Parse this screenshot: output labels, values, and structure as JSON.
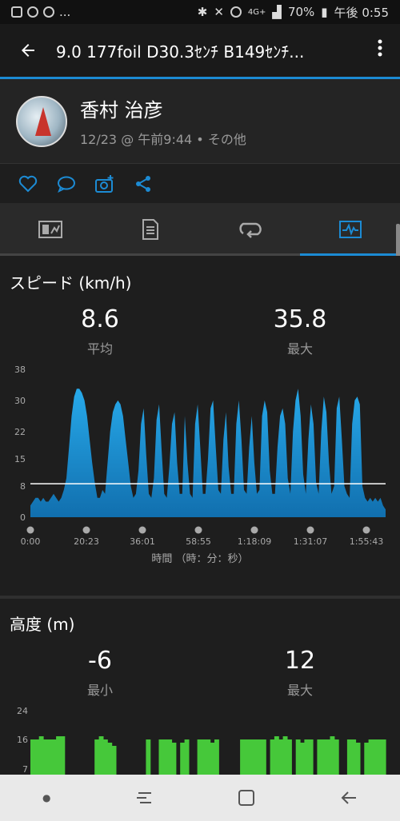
{
  "status_bar": {
    "left_icons": [
      "image-icon",
      "sync-icon",
      "message-icon"
    ],
    "left_more": "...",
    "battery": "70%",
    "time": "午後 0:55",
    "network": "4G+"
  },
  "app_bar": {
    "title": "9.0  177foil  D30.3ｾﾝﾁ  B149ｾﾝﾁ...",
    "back_icon": "arrow-left-icon",
    "more_icon": "overflow-menu-icon"
  },
  "profile": {
    "name": "香村 治彦",
    "meta": "12/23 @ 午前9:44 • その他"
  },
  "actions": [
    "heart-icon",
    "comment-icon",
    "add-photo-icon",
    "share-icon"
  ],
  "tabs": [
    {
      "icon": "overview-icon",
      "active": false
    },
    {
      "icon": "details-icon",
      "active": false
    },
    {
      "icon": "laps-icon",
      "active": false
    },
    {
      "icon": "charts-icon",
      "active": true
    }
  ],
  "speed": {
    "title": "スピード (km/h)",
    "avg_value": "8.6",
    "avg_label": "平均",
    "max_value": "35.8",
    "max_label": "最大",
    "xlabel": "時間 （時：分：秒）"
  },
  "altitude": {
    "title": "高度 (m)",
    "min_value": "-6",
    "min_label": "最小",
    "max_value": "12",
    "max_label": "最大"
  },
  "colors": {
    "accent": "#1c8bd4",
    "speed_fill": "#1a97d6",
    "altitude_fill": "#46c83a"
  },
  "chart_data": [
    {
      "type": "area",
      "title": "スピード (km/h)",
      "xlabel": "時間 （時：分：秒）",
      "x_ticks": [
        "0:00",
        "20:23",
        "36:01",
        "58:55",
        "1:18:09",
        "1:31:07",
        "1:55:43"
      ],
      "y_ticks": [
        0,
        8,
        15,
        22,
        30,
        38
      ],
      "ylim": [
        0,
        38
      ],
      "average_line": 8.6,
      "series": [
        {
          "values": [
            3,
            4,
            5,
            5,
            4,
            5,
            4,
            4,
            5,
            6,
            5,
            4,
            5,
            7,
            10,
            18,
            26,
            31,
            33,
            33,
            32,
            30,
            26,
            20,
            14,
            9,
            5,
            5,
            7,
            6,
            14,
            22,
            27,
            29,
            30,
            29,
            26,
            20,
            14,
            8,
            5,
            6,
            12,
            24,
            28,
            16,
            6,
            5,
            10,
            25,
            29,
            17,
            6,
            5,
            13,
            24,
            27,
            14,
            6,
            6,
            26,
            14,
            6,
            5,
            24,
            29,
            18,
            6,
            6,
            15,
            28,
            30,
            18,
            7,
            6,
            20,
            27,
            13,
            6,
            6,
            24,
            30,
            20,
            7,
            6,
            18,
            26,
            14,
            6,
            7,
            26,
            30,
            27,
            12,
            6,
            6,
            18,
            26,
            28,
            24,
            10,
            6,
            22,
            30,
            33,
            26,
            11,
            6,
            20,
            29,
            24,
            9,
            6,
            22,
            31,
            27,
            14,
            6,
            8,
            28,
            31,
            20,
            8,
            6,
            5,
            24,
            30,
            31,
            29,
            8,
            5,
            4,
            5,
            4,
            5,
            4,
            5,
            3,
            2
          ]
        }
      ]
    },
    {
      "type": "area",
      "title": "高度 (m)",
      "y_ticks": [
        7,
        16,
        24
      ],
      "series": [
        {
          "values": [
            5,
            5,
            6,
            5,
            5,
            5,
            6,
            6,
            0,
            0,
            0,
            0,
            0,
            0,
            0,
            5,
            6,
            5,
            4,
            3,
            0,
            0,
            0,
            0,
            0,
            0,
            0,
            5,
            0,
            0,
            5,
            5,
            5,
            4,
            0,
            4,
            5,
            0,
            0,
            5,
            5,
            5,
            4,
            5,
            0,
            0,
            0,
            0,
            0,
            5,
            5,
            5,
            5,
            5,
            5,
            0,
            5,
            6,
            5,
            6,
            5,
            0,
            5,
            4,
            5,
            5,
            0,
            5,
            5,
            5,
            6,
            5,
            0,
            0,
            5,
            5,
            4,
            0,
            4,
            5,
            5,
            5,
            5
          ]
        }
      ]
    }
  ]
}
